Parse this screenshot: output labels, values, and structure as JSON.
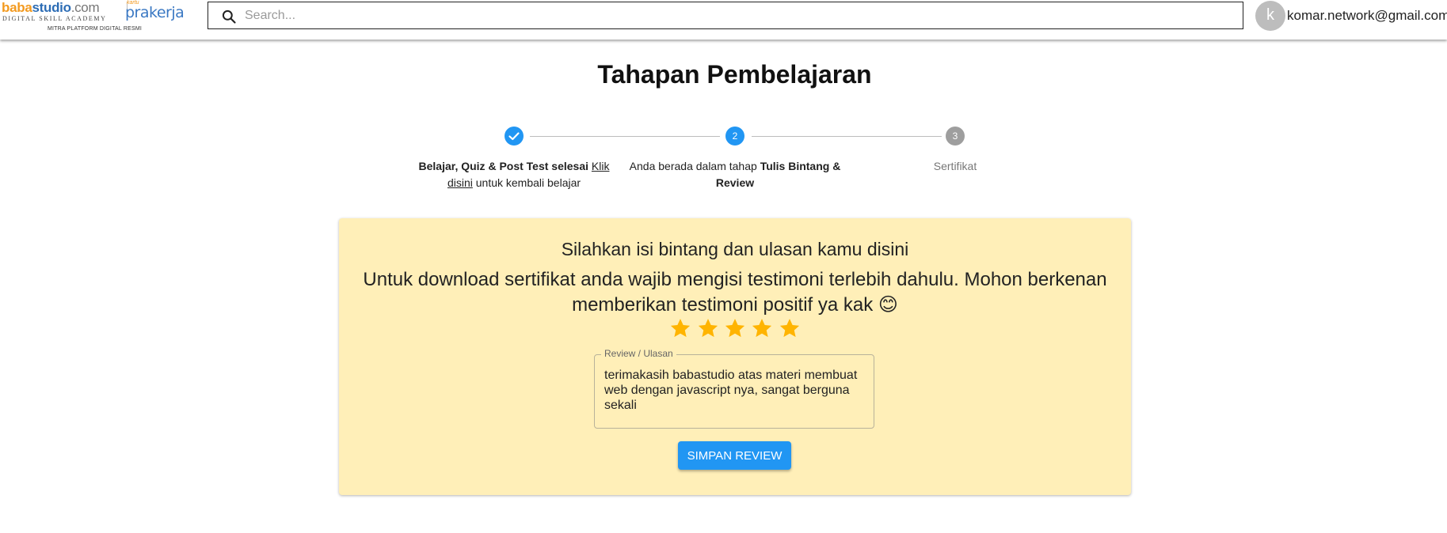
{
  "header": {
    "logo_part1": "baba",
    "logo_part2": "studio",
    "logo_part3": ".com",
    "logo_subtitle": "DIGITAL SKILL ACADEMY",
    "partner_small": "kartu",
    "partner_name": "prakerja",
    "tagline": "MITRA PLATFORM DIGITAL RESMI",
    "search_placeholder": "Search...",
    "avatar_letter": "k",
    "user_email": "komar.network@gmail.com"
  },
  "page": {
    "title": "Tahapan Pembelajaran"
  },
  "stepper": {
    "steps": [
      {
        "number": "✓",
        "status": "completed",
        "text_bold": "Belajar, Quiz & Post Test selesai",
        "link": "Klik disini",
        "text_after": "untuk kembali belajar"
      },
      {
        "number": "2",
        "status": "active",
        "text_before": "Anda berada dalam tahap",
        "text_bold": "Tulis Bintang & Review"
      },
      {
        "number": "3",
        "status": "inactive",
        "label": "Sertifikat"
      }
    ]
  },
  "review_card": {
    "heading": "Silahkan isi bintang dan ulasan kamu disini",
    "message": "Untuk download sertifikat anda wajib mengisi testimoni terlebih dahulu. Mohon berkenan memberikan testimoni positif ya kak 😊",
    "rating": 5,
    "max_rating": 5,
    "field_label": "Review / Ulasan",
    "field_value": "terimakasih babastudio atas materi membuat web dengan javascript nya, sangat berguna sekali",
    "submit_label": "SIMPAN REVIEW"
  },
  "colors": {
    "primary": "#2196f3",
    "card_bg": "#ffefb8",
    "star": "#ffb400",
    "inactive_step": "#9e9e9e"
  }
}
